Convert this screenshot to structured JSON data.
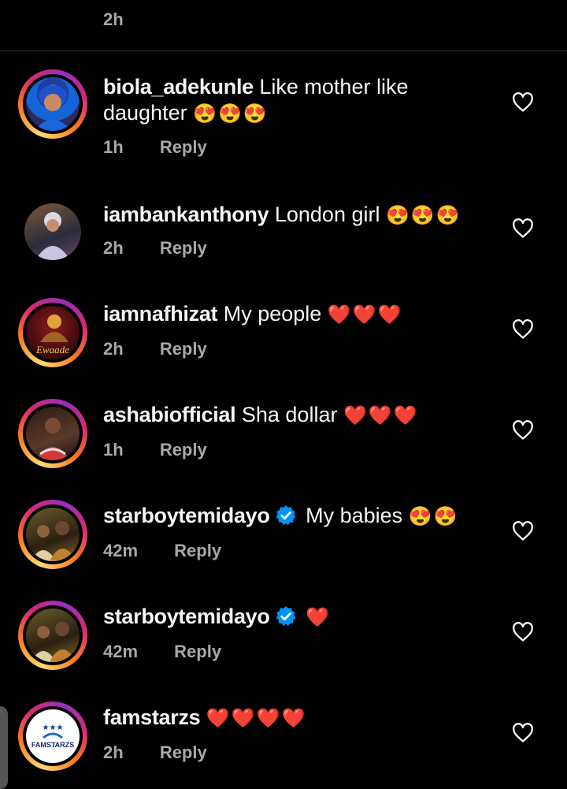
{
  "previous": {
    "time": "2h"
  },
  "reply_label": "Reply",
  "comments": [
    {
      "username": "biola_adekunle",
      "text": "Like mother like",
      "text2": "daughter",
      "emoji": "😍😍😍",
      "time": "1h"
    },
    {
      "username": "iambankanthony",
      "text": "London girl",
      "emoji": "😍😍😍",
      "time": "2h"
    },
    {
      "username": "iamnafhizat",
      "text": "My people",
      "emoji": "❤️❤️❤️",
      "time": "2h"
    },
    {
      "username": "ashabiofficial",
      "text": "Sha dollar",
      "emoji": "❤️❤️❤️",
      "time": "1h"
    },
    {
      "username": "starboytemidayo",
      "text": "My babies",
      "emoji": "😍😍",
      "time": "42m",
      "verified": true
    },
    {
      "username": "starboytemidayo",
      "text": "",
      "emoji": "❤️",
      "time": "42m",
      "verified": true
    },
    {
      "username": "famstarzs",
      "text": "",
      "emoji": "❤️❤️❤️❤️",
      "time": "2h"
    }
  ],
  "avatar_texts": {
    "ewaade": "Ewaade",
    "famstarzs": "FAMSTARZS"
  },
  "icons": {
    "like": "heart-outline-icon",
    "verified": "verified-badge-icon"
  },
  "colors": {
    "background": "#000000",
    "text": "#f5f5f5",
    "secondary": "#a8a8a8",
    "verified": "#0095f6",
    "heart": "#e0212f"
  }
}
